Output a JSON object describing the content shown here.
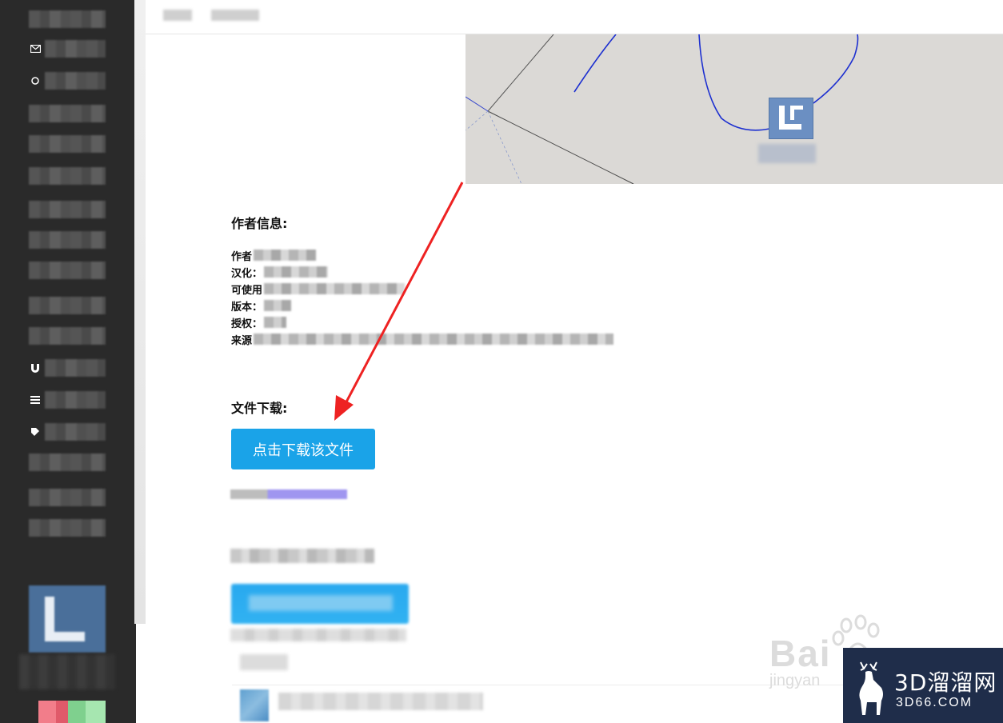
{
  "sidebar": {
    "icons": [
      "mail-icon",
      "circle-icon",
      "magnet-icon",
      "list-icon",
      "tag-icon"
    ]
  },
  "author_section": {
    "title": "作者信息:",
    "rows": [
      {
        "label": "作者"
      },
      {
        "label": "汉化："
      },
      {
        "label": "可使用"
      },
      {
        "label": "版本："
      },
      {
        "label": "授权："
      },
      {
        "label": "来源"
      }
    ]
  },
  "download_section": {
    "title": "文件下载:",
    "button_label": "点击下载该文件"
  },
  "watermarks": {
    "baidu_word": "Bai",
    "baidu_sub": "jingyan",
    "brand_name": "3D溜溜网",
    "brand_domain": "3D66.COM"
  },
  "colors": {
    "accent": "#1aa3e8",
    "arrow": "#ee2222",
    "sidebar_bg": "#2a2a2a",
    "brand_bg": "#1f2d4a"
  }
}
